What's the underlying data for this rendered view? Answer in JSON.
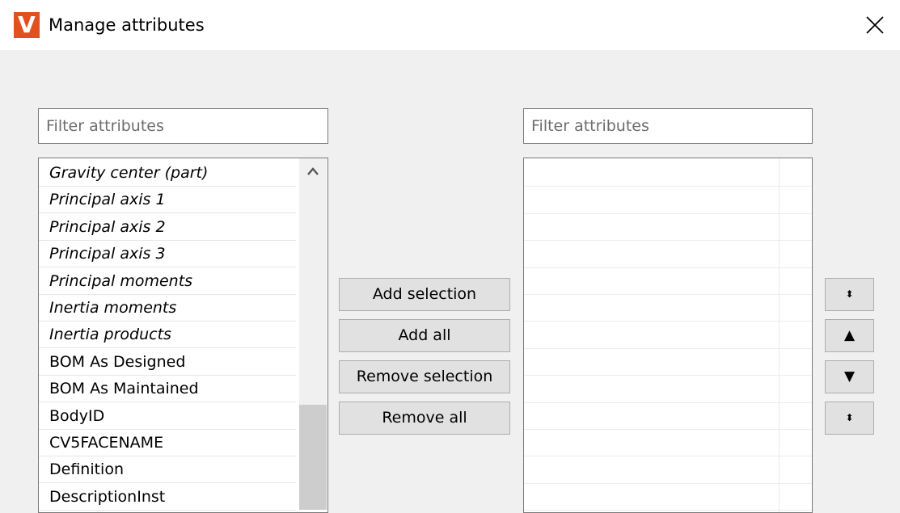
{
  "window": {
    "title": "Manage attributes",
    "logo_letter": "V",
    "logo_color": "#e2501f",
    "close_glyph": "✕"
  },
  "left_panel": {
    "filter_placeholder": "Filter attributes",
    "items": [
      {
        "label": "Gravity center (part)",
        "italic": true
      },
      {
        "label": "Principal axis 1",
        "italic": true
      },
      {
        "label": "Principal axis 2",
        "italic": true
      },
      {
        "label": "Principal axis 3",
        "italic": true
      },
      {
        "label": "Principal moments",
        "italic": true
      },
      {
        "label": "Inertia moments",
        "italic": true
      },
      {
        "label": "Inertia products",
        "italic": true
      },
      {
        "label": "BOM As Designed",
        "italic": false
      },
      {
        "label": "BOM As Maintained",
        "italic": false
      },
      {
        "label": "BodyID",
        "italic": false
      },
      {
        "label": "CV5FACENAME",
        "italic": false
      },
      {
        "label": "Definition",
        "italic": false
      },
      {
        "label": "DescriptionInst",
        "italic": false
      }
    ],
    "scroll_up_icon": "chevron-up-icon"
  },
  "middle_buttons": {
    "add_selection": "Add selection",
    "add_all": "Add all",
    "remove_selection": "Remove selection",
    "remove_all": "Remove all"
  },
  "right_panel": {
    "filter_placeholder": "Filter attributes",
    "items": []
  },
  "order_buttons": {
    "move_top_glyph": "⬍",
    "move_up_glyph": "▲",
    "move_down_glyph": "▼",
    "move_bottom_glyph": "⬍"
  }
}
